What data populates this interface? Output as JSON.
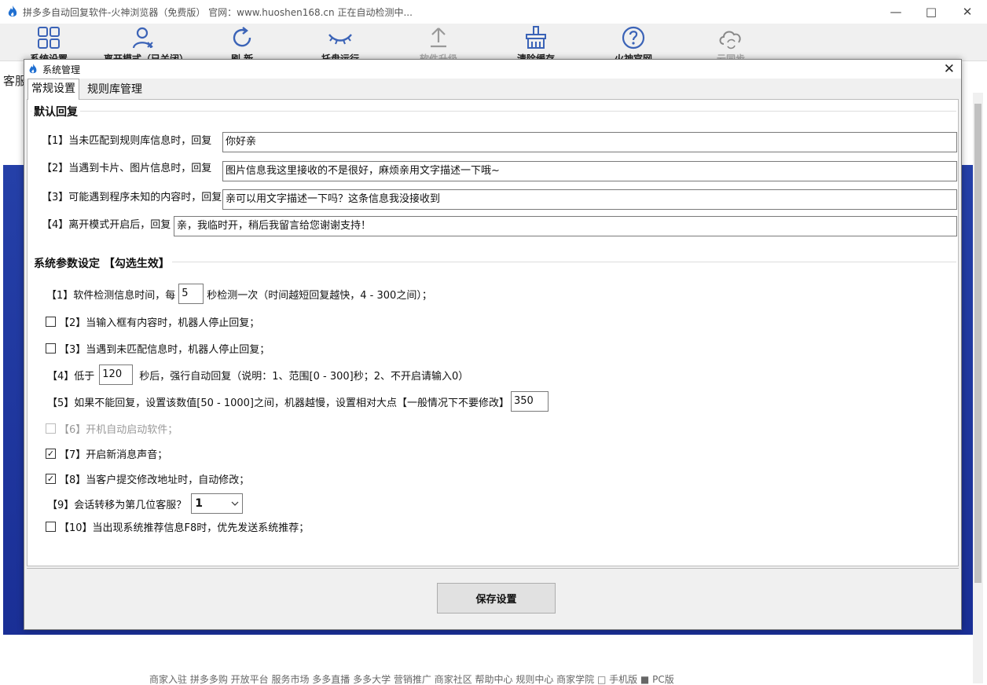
{
  "window": {
    "title": "拼多多自动回复软件-火神浏览器（免费版） 官网：www.huoshen168.cn  正在自动检测中..."
  },
  "toolbar": {
    "items": [
      {
        "label": "系统设置",
        "icon": "grid-icon"
      },
      {
        "label": "离开模式（已关闭）",
        "icon": "user-icon"
      },
      {
        "label": "刷 新",
        "icon": "refresh-icon"
      },
      {
        "label": "托盘运行",
        "icon": "eye-closed-icon"
      },
      {
        "label": "软件升级",
        "icon": "upload-icon"
      },
      {
        "label": "清除缓存",
        "icon": "broom-icon"
      },
      {
        "label": "火神官网",
        "icon": "help-icon"
      },
      {
        "label": "云同步",
        "icon": "cloud-sync-icon"
      }
    ]
  },
  "background": {
    "tab_label": "客服",
    "footer_text": "商家入驻  拼多多购  开放平台  服务市场  多多直播  多多大学  营销推广  商家社区  帮助中心  规则中心  商家学院  □ 手机版  ■ PC版"
  },
  "dialog": {
    "title": "系统管理",
    "tabs": [
      "常规设置",
      "规则库管理"
    ],
    "default_reply": {
      "section_title": "默认回复",
      "rows": [
        {
          "label": "【1】当未匹配到规则库信息时，回复",
          "value": "你好亲"
        },
        {
          "label": "【2】当遇到卡片、图片信息时，回复",
          "value": "图片信息我这里接收的不是很好，麻烦亲用文字描述一下哦~"
        },
        {
          "label": "【3】可能遇到程序未知的内容时，回复",
          "value": "亲可以用文字描述一下吗？这条信息我没接收到"
        },
        {
          "label": "【4】离开模式开启后，回复",
          "value": "亲，我临时开，稍后我留言给您谢谢支持！"
        }
      ]
    },
    "params": {
      "section_title": "系统参数设定 【勾选生效】",
      "p1_before": "【1】软件检测信息时间，每",
      "p1_value": "5",
      "p1_after": "秒检测一次（时间越短回复越快，4 - 300之间）；",
      "p2": {
        "label": "【2】当输入框有内容时，机器人停止回复；",
        "checked": false
      },
      "p3": {
        "label": "【3】当遇到未匹配信息时，机器人停止回复；",
        "checked": false
      },
      "p4_before": "【4】低于",
      "p4_value": "120",
      "p4_after": "秒后，强行自动回复（说明：1、范围[0 - 300]秒；2、不开启请输入0）",
      "p5_label": "【5】如果不能回复，设置该数值[50 - 1000]之间，机器越慢，设置相对大点【一般情况下不要修改】",
      "p5_value": "350",
      "p6": {
        "label": "【6】开机自动启动软件；",
        "checked": false,
        "disabled": true
      },
      "p7": {
        "label": "【7】开启新消息声音；",
        "checked": true
      },
      "p8": {
        "label": "【8】当客户提交修改地址时，自动修改；",
        "checked": true
      },
      "p9_label": "【9】会话转移为第几位客服？",
      "p9_value": "1",
      "p10": {
        "label": "【10】当出现系统推荐信息F8时，优先发送系统推荐；",
        "checked": false
      }
    },
    "save_label": "保存设置"
  }
}
